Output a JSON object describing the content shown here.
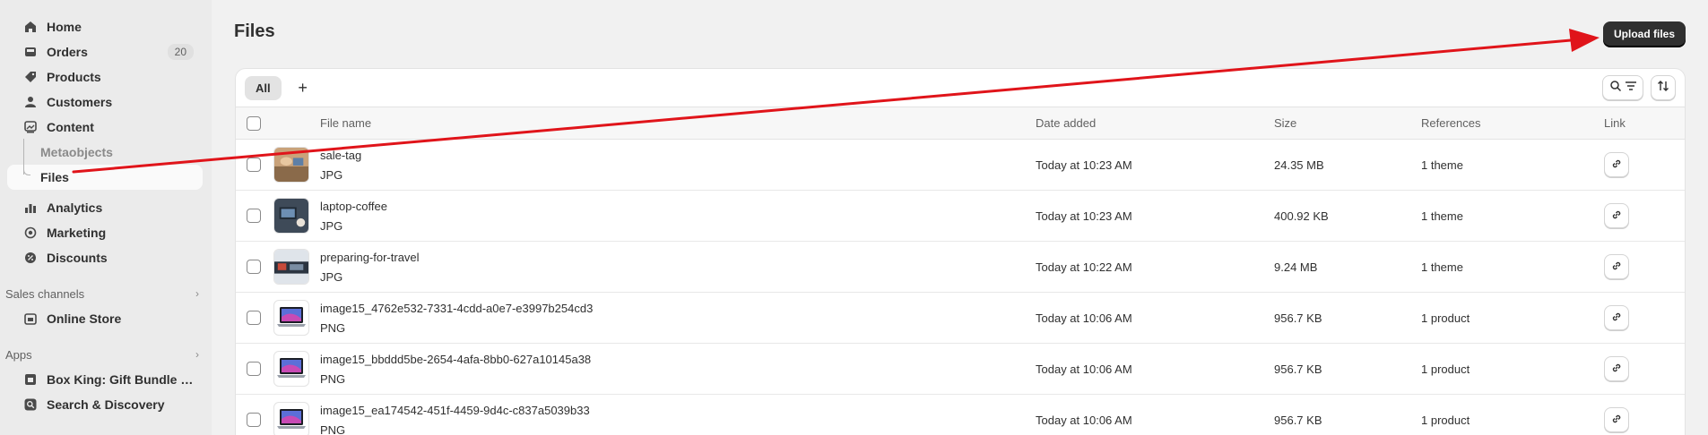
{
  "sidebar": {
    "items": [
      {
        "label": "Home",
        "icon": "home-icon"
      },
      {
        "label": "Orders",
        "icon": "orders-icon",
        "badge": "20"
      },
      {
        "label": "Products",
        "icon": "tag-icon"
      },
      {
        "label": "Customers",
        "icon": "person-icon"
      },
      {
        "label": "Content",
        "icon": "content-icon"
      }
    ],
    "content_sub": [
      {
        "label": "Metaobjects"
      },
      {
        "label": "Files"
      }
    ],
    "items2": [
      {
        "label": "Analytics",
        "icon": "analytics-icon"
      },
      {
        "label": "Marketing",
        "icon": "target-icon"
      },
      {
        "label": "Discounts",
        "icon": "discount-icon"
      }
    ],
    "sales_channels": {
      "heading": "Sales channels",
      "items": [
        {
          "label": "Online Store",
          "icon": "store-icon"
        }
      ]
    },
    "apps": {
      "heading": "Apps",
      "items": [
        {
          "label": "Box King: Gift Bundle Buil...",
          "icon": "app-icon"
        },
        {
          "label": "Search & Discovery",
          "icon": "search-icon"
        }
      ]
    }
  },
  "page": {
    "title": "Files",
    "upload_label": "Upload files"
  },
  "tabs": {
    "all": "All",
    "add": "+"
  },
  "table": {
    "headers": {
      "name": "File name",
      "date": "Date added",
      "size": "Size",
      "references": "References",
      "link": "Link"
    },
    "rows": [
      {
        "name": "sale-tag",
        "type": "JPG",
        "date": "Today at 10:23 AM",
        "size": "24.35 MB",
        "references": "1 theme",
        "thumb": "photo-hands"
      },
      {
        "name": "laptop-coffee",
        "type": "JPG",
        "date": "Today at 10:23 AM",
        "size": "400.92 KB",
        "references": "1 theme",
        "thumb": "photo-laptop"
      },
      {
        "name": "preparing-for-travel",
        "type": "JPG",
        "date": "Today at 10:22 AM",
        "size": "9.24 MB",
        "references": "1 theme",
        "thumb": "photo-travel"
      },
      {
        "name": "image15_4762e532-7331-4cdd-a0e7-e3997b254cd3",
        "type": "PNG",
        "date": "Today at 10:06 AM",
        "size": "956.7 KB",
        "references": "1 product",
        "thumb": "laptop"
      },
      {
        "name": "image15_bbddd5be-2654-4afa-8bb0-627a10145a38",
        "type": "PNG",
        "date": "Today at 10:06 AM",
        "size": "956.7 KB",
        "references": "1 product",
        "thumb": "laptop"
      },
      {
        "name": "image15_ea174542-451f-4459-9d4c-c837a5039b33",
        "type": "PNG",
        "date": "Today at 10:06 AM",
        "size": "956.7 KB",
        "references": "1 product",
        "thumb": "laptop"
      }
    ]
  },
  "colors": {
    "annotation_arrow": "#e0141a",
    "primary_button": "#303030"
  }
}
